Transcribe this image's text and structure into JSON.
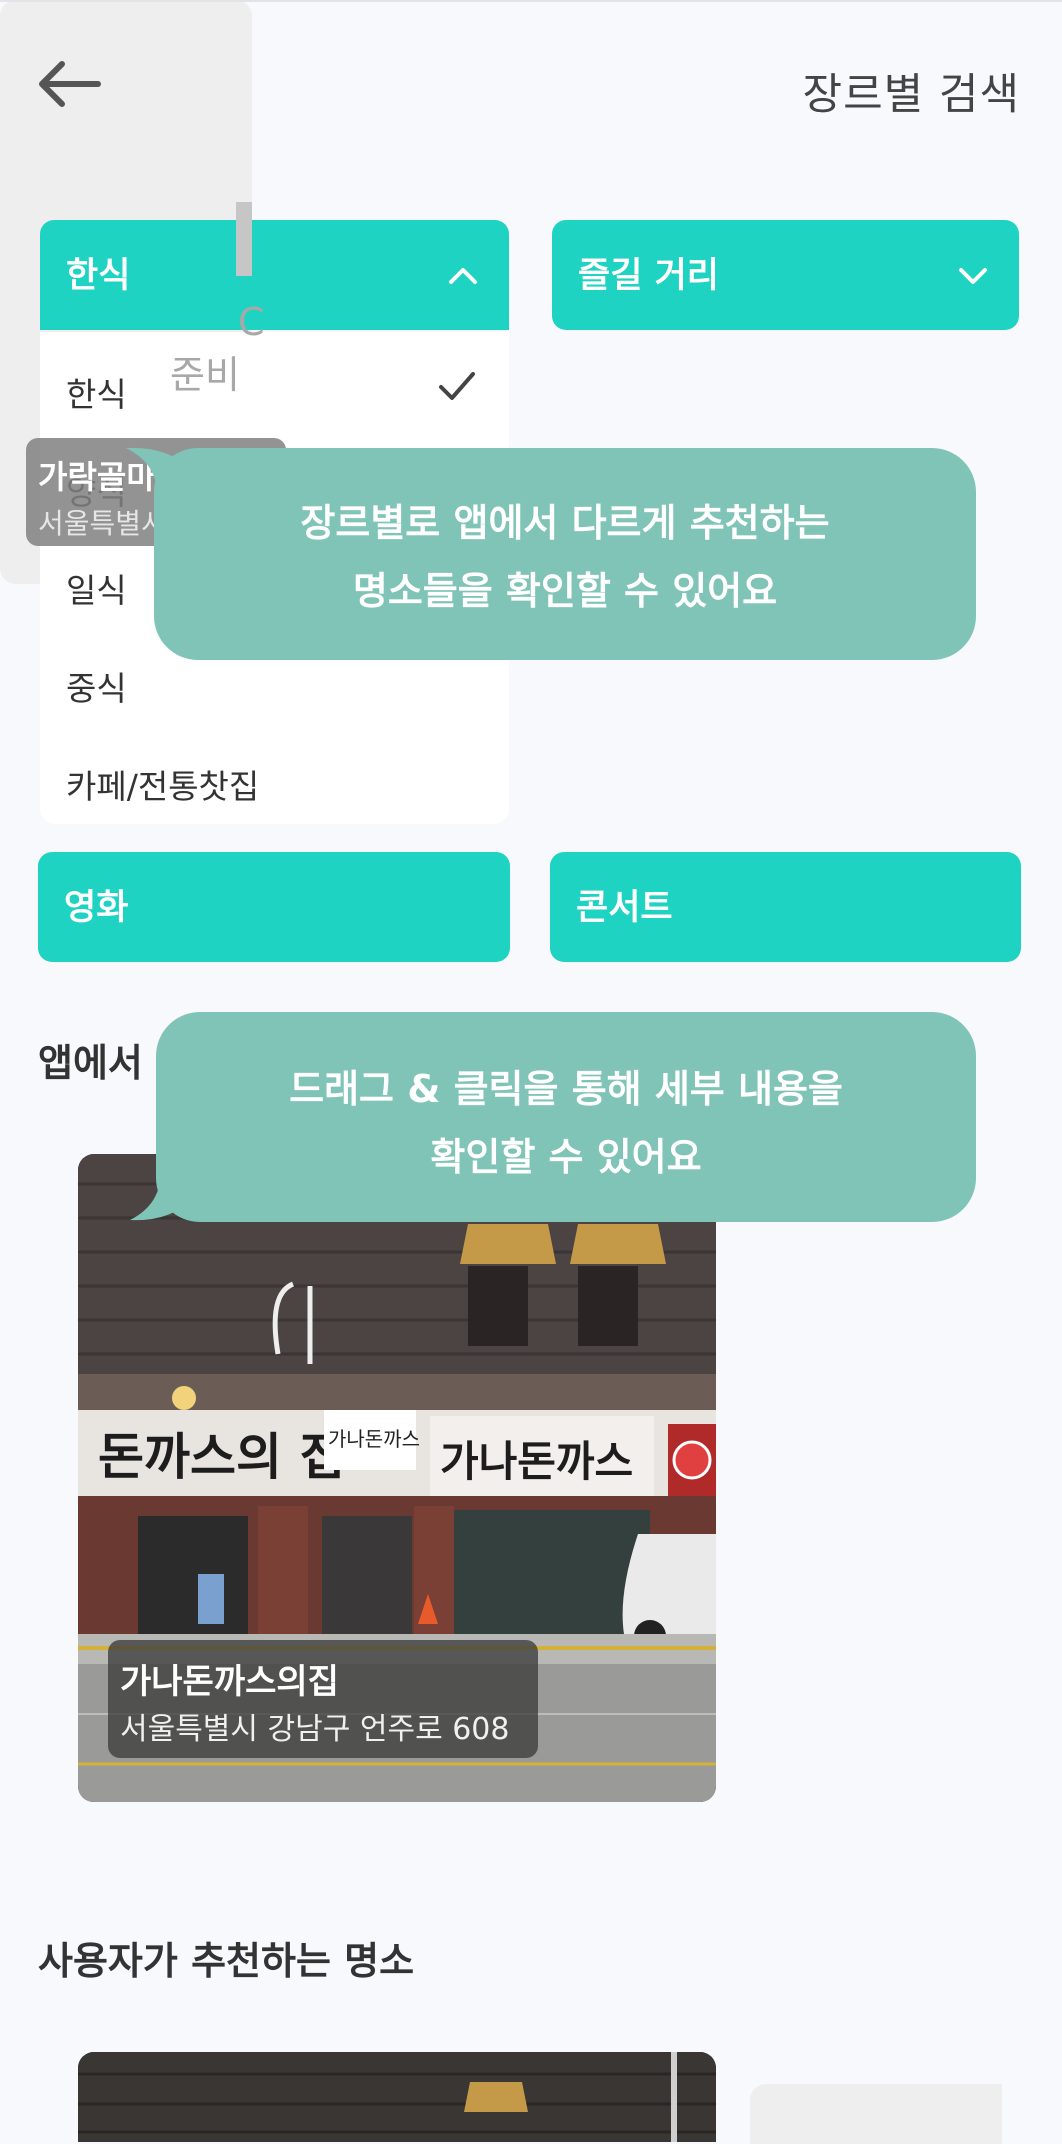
{
  "header": {
    "title": "장르별 검색",
    "back_icon": "arrow-left-icon"
  },
  "filters": {
    "food": {
      "label": "한식",
      "state": "open",
      "chevron": "chevron-up-icon"
    },
    "fun": {
      "label": "즐길 거리",
      "state": "closed",
      "chevron": "chevron-down-icon"
    },
    "movie": {
      "label": "영화"
    },
    "concert": {
      "label": "콘서트"
    }
  },
  "food_menu": {
    "items": [
      "한식",
      "양식",
      "일식",
      "중식",
      "카페/전통찻집"
    ],
    "selected": "한식"
  },
  "tooltips": {
    "genre": [
      "장르별로 앱에서 다르게 추천하는",
      "명소들을 확인할 수 있어요"
    ],
    "drag": [
      "드래그 & 클릭을 통해 세부 내용을",
      "확인할 수 있어요"
    ]
  },
  "sections": {
    "app_title": "앱에서",
    "user_title": "사용자가 추천하는 명소"
  },
  "app_places": [
    {
      "name": "가나돈까스의집",
      "address": "서울특별시 강남구 언주로 608"
    },
    {
      "name": "가락골마산아구",
      "address": "서울특별시 송파구",
      "placeholder": "준비"
    }
  ],
  "photo_signs": {
    "sign_left": "돈까스의 집",
    "sign_small": "가나돈까스",
    "sign_right": "가나돈까스"
  },
  "colors": {
    "accent": "#1fd3c2",
    "tooltip": "#7fc4b7",
    "background": "#f8f9fd"
  }
}
